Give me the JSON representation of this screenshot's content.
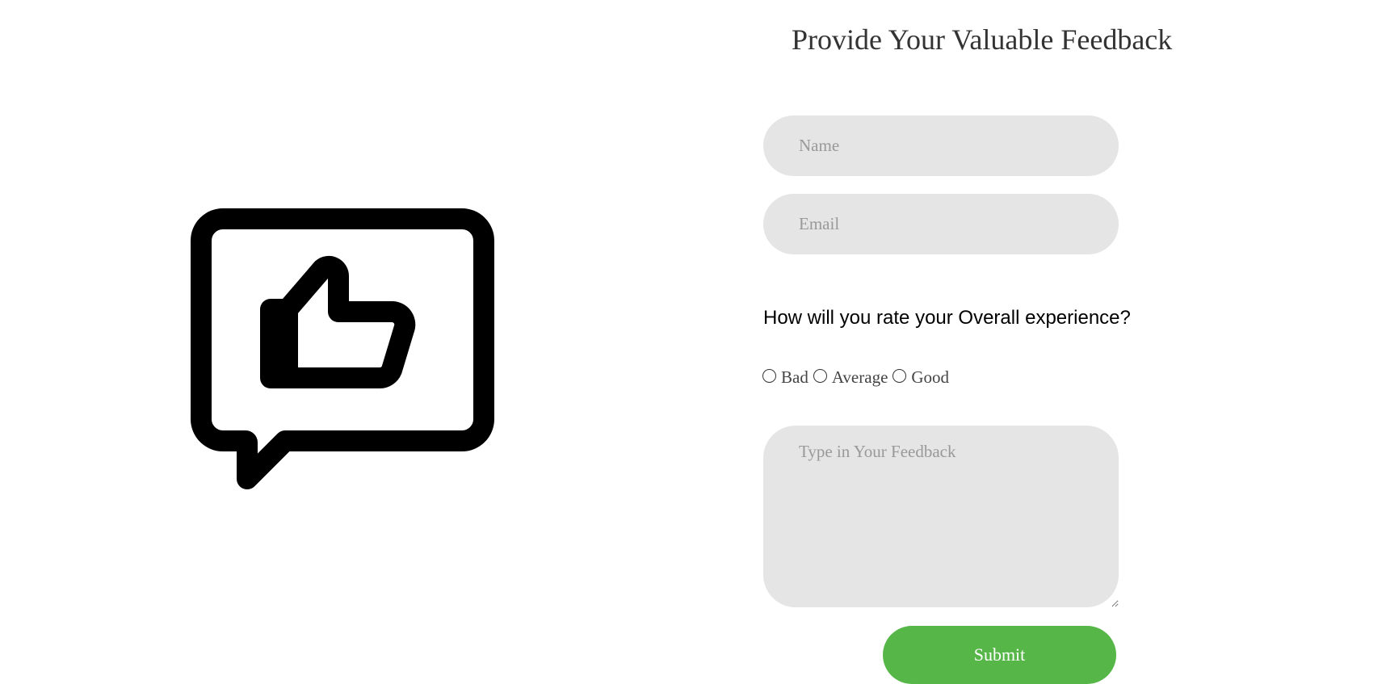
{
  "form": {
    "title": "Provide Your Valuable Feedback",
    "name_placeholder": "Name",
    "email_placeholder": "Email",
    "question": "How will you rate your Overall experience?",
    "ratings": [
      {
        "label": "Bad"
      },
      {
        "label": "Average"
      },
      {
        "label": "Good"
      }
    ],
    "feedback_placeholder": "Type in Your Feedback",
    "submit_label": "Submit"
  },
  "illustration": {
    "icon": "thumbs-up-speech-bubble-icon"
  },
  "colors": {
    "submit_bg": "#56b748",
    "field_bg": "#e5e5e5",
    "title": "#333333"
  }
}
